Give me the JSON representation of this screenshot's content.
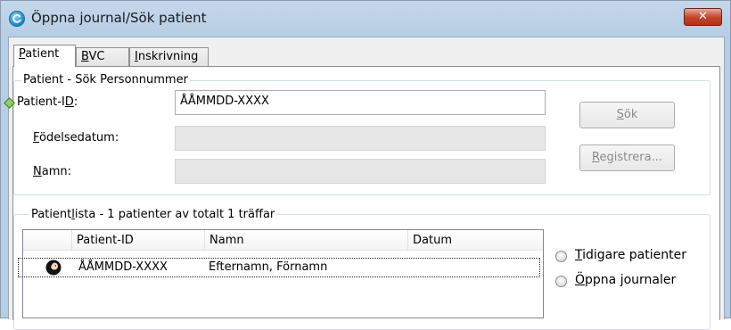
{
  "window": {
    "title": "Öppna journal/Sök patient",
    "close_glyph": "✕"
  },
  "tabs": [
    {
      "label": "Patient",
      "mnemonic": "P",
      "active": true
    },
    {
      "label": "BVC",
      "mnemonic": "B",
      "active": false
    },
    {
      "label": "Inskrivning",
      "mnemonic": "I",
      "active": false
    }
  ],
  "search_group": {
    "title": "Patient - Sök Personnummer",
    "patient_id_label_pre": "Patient-I",
    "patient_id_label_ul": "D",
    "patient_id_label_post": ":",
    "patient_id_value": "ÅÅMMDD-XXXX",
    "birthdate_label_ul": "F",
    "birthdate_label_rest": "ödelsedatum:",
    "birthdate_value": "",
    "name_label_ul": "N",
    "name_label_rest": "amn:",
    "name_value": "",
    "search_button_ul": "S",
    "search_button_rest": "ök",
    "register_button_ul": "R",
    "register_button_rest": "egistrera...",
    "required_indicator_color": "#8ed05a"
  },
  "list_group": {
    "title_pre": "Patient",
    "title_ul": "l",
    "title_post": "ista - 1 patienter av totalt 1 träffar",
    "columns": [
      "Patient-ID",
      "Namn",
      "Datum"
    ],
    "rows": [
      {
        "icon": "patient-icon",
        "patient_id": "ÅÅMMDD-XXXX",
        "name": "Efternamn, Förnamn",
        "date": ""
      }
    ]
  },
  "options": {
    "previous_patients_ul": "T",
    "previous_patients_rest": "idigare patienter",
    "open_journals_ul": "Ö",
    "open_journals_rest": "ppna journaler"
  }
}
